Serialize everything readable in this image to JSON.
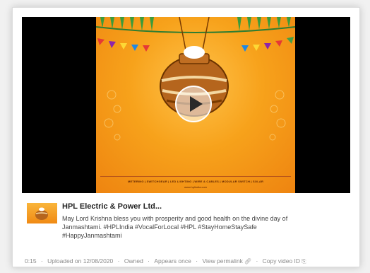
{
  "video": {
    "banner_text": "METERING | SWITCHGEAR | LED LIGHTING | WIRE & CABLES | MODULAR SWITCH | SOLAR",
    "banner_url": "www.hplindia.com",
    "play_icon": "play-icon"
  },
  "post": {
    "title": "HPL Electric & Power Ltd...",
    "description_line1": "May Lord Krishna bless you with prosperity and good health on the divine day of",
    "description_line2": "Janmashtami. #HPLIndia #VocalForLocal #HPL #StayHomeStaySafe",
    "description_line3": "#HappyJanmashtami"
  },
  "meta": {
    "duration": "0:15",
    "uploaded": "Uploaded on 12/08/2020",
    "owned": "Owned",
    "appears": "Appears once",
    "permalink": "View permalink",
    "copy_id": "Copy video ID",
    "link_icon": "link-icon",
    "copy_icon": "copy-icon",
    "separator": "·"
  },
  "colors": {
    "background": "#f1f1f1",
    "card": "#ffffff",
    "video_bg": "#000000",
    "frame_orange": "#f7a21b",
    "meta_text": "#8a8a8a"
  }
}
